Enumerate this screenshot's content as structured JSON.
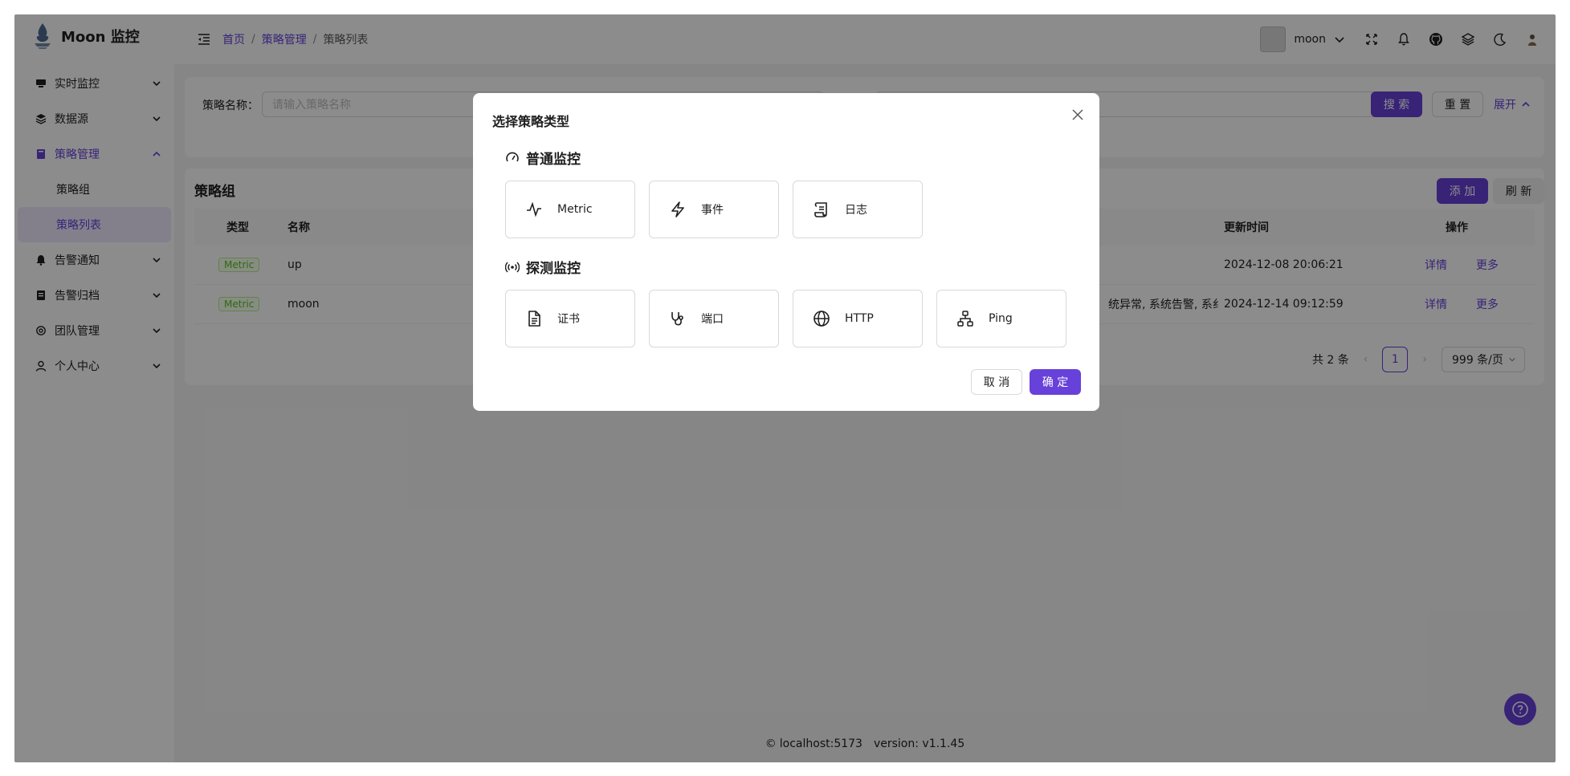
{
  "app": {
    "title": "Moon 监控"
  },
  "sidebar": {
    "items": [
      {
        "label": "实时监控",
        "icon": "monitor-icon"
      },
      {
        "label": "数据源",
        "icon": "layers-icon"
      },
      {
        "label": "策略管理",
        "icon": "book-icon",
        "expanded": true,
        "children": [
          {
            "label": "策略组"
          },
          {
            "label": "策略列表",
            "selected": true
          }
        ]
      },
      {
        "label": "告警通知",
        "icon": "bell-icon"
      },
      {
        "label": "告警归档",
        "icon": "archive-icon"
      },
      {
        "label": "团队管理",
        "icon": "gear-icon"
      },
      {
        "label": "个人中心",
        "icon": "user-icon"
      }
    ]
  },
  "header": {
    "breadcrumb": [
      "首页",
      "策略管理",
      "策略列表"
    ],
    "user_name": "moon"
  },
  "search": {
    "name_label": "策略名称：",
    "name_placeholder": "请输入策略名称",
    "search_label": "搜 索",
    "reset_label": "重 置",
    "expand_label": "展开"
  },
  "table": {
    "title": "策略组",
    "add_label": "添 加",
    "refresh_label": "刷 新",
    "columns": {
      "type": "类型",
      "name": "名称",
      "updated": "更新时间",
      "actions": "操作"
    },
    "rows": [
      {
        "type": "Metric",
        "name": "up",
        "labels": "",
        "updated": "2024-12-08 20:06:21",
        "detail": "详情",
        "more": "更多"
      },
      {
        "type": "Metric",
        "name": "moon",
        "labels": "统异常, 系统告警, 系纟",
        "updated": "2024-12-14 09:12:59",
        "detail": "详情",
        "more": "更多"
      }
    ],
    "pagination": {
      "total": "共 2 条",
      "current": "1",
      "page_size": "999 条/页"
    }
  },
  "footer": {
    "host": "localhost:5173",
    "version": "version: v1.1.45"
  },
  "modal": {
    "title": "选择策略类型",
    "section1": {
      "title": "普通监控",
      "options": [
        "Metric",
        "事件",
        "日志"
      ]
    },
    "section2": {
      "title": "探测监控",
      "options": [
        "证书",
        "端口",
        "HTTP",
        "Ping"
      ]
    },
    "cancel_label": "取 消",
    "ok_label": "确 定"
  },
  "colors": {
    "accent": "#6741d9",
    "mask": "rgba(0,0,0,0.45)",
    "tag_green": "#52c41a"
  }
}
